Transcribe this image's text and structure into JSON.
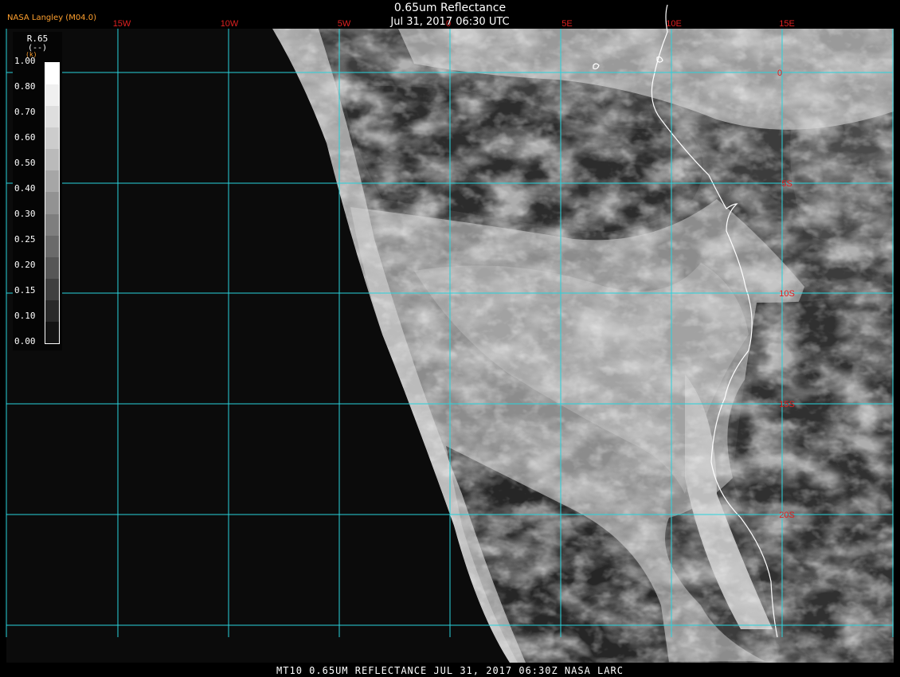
{
  "header": {
    "agency_label": "NASA Langley (M04.0)",
    "title": "0.65um Reflectance",
    "subtitle": "Jul 31, 2017 06:30 UTC"
  },
  "footer": {
    "text": "MT10  0.65UM REFLECTANCE   JUL 31, 2017 06:30Z   NASA LARC"
  },
  "legend": {
    "name": "R.65",
    "unit": "(--)",
    "unit_small": "(k)",
    "values": [
      "1.00",
      "0.80",
      "0.70",
      "0.60",
      "0.50",
      "0.40",
      "0.30",
      "0.25",
      "0.20",
      "0.15",
      "0.10",
      "0.00"
    ],
    "shades": [
      "#ffffff",
      "#f0f0f0",
      "#dedede",
      "#cccccc",
      "#bababa",
      "#a6a6a6",
      "#929292",
      "#7e7e7e",
      "#6a6a6a",
      "#565656",
      "#404040",
      "#2a2a2a",
      "#141414"
    ]
  },
  "map": {
    "longitude_labels": [
      "15W",
      "10W",
      "5W",
      "0",
      "5E",
      "10E",
      "15E"
    ],
    "latitude_labels": [
      "0",
      "5S",
      "10S",
      "15S",
      "20S"
    ],
    "colors": {
      "grid": "#29d3dc",
      "labels": "#e02020",
      "coastline": "#ffffff",
      "space": "#0b0b0b"
    }
  }
}
